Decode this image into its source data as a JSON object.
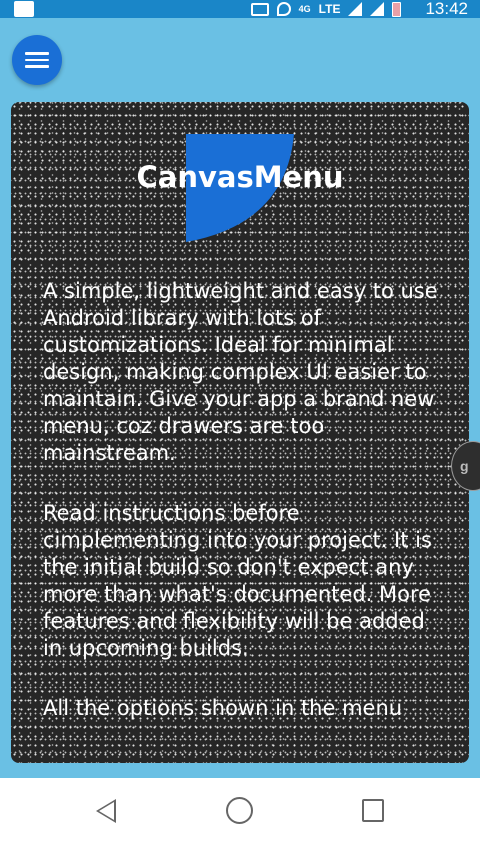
{
  "status_bar": {
    "network_label": "4G",
    "lte_label": "LTE",
    "time": "13:42",
    "icons": [
      "cast-icon",
      "wifi-call-icon",
      "signal-icon",
      "signal-icon",
      "battery-icon"
    ]
  },
  "menu_button": {
    "icon": "hamburger-menu-icon"
  },
  "card": {
    "title": "CanvasMenu",
    "logo_color": "#1a6fd6",
    "paragraphs": [
      "A simple, lightweight and easy to use Android library with lots of customizations. Ideal for minimal design, making complex UI easier to maintain. Give your app a brand new menu, coz drawers are too mainstream.",
      "Read instructions before cimplementing into your project. It is the initial build so don't expect any more than what's documented. More features and flexibility will be added in upcoming builds.",
      "All the options shown in the menu"
    ],
    "edge_handle_text": "g"
  },
  "nav_bar": {
    "icons": [
      "back-icon",
      "home-icon",
      "recents-icon"
    ]
  },
  "colors": {
    "background": "#6ac0e4",
    "status_bar": "#1a86c8",
    "accent": "#1a6fd6",
    "card": "#262626"
  }
}
